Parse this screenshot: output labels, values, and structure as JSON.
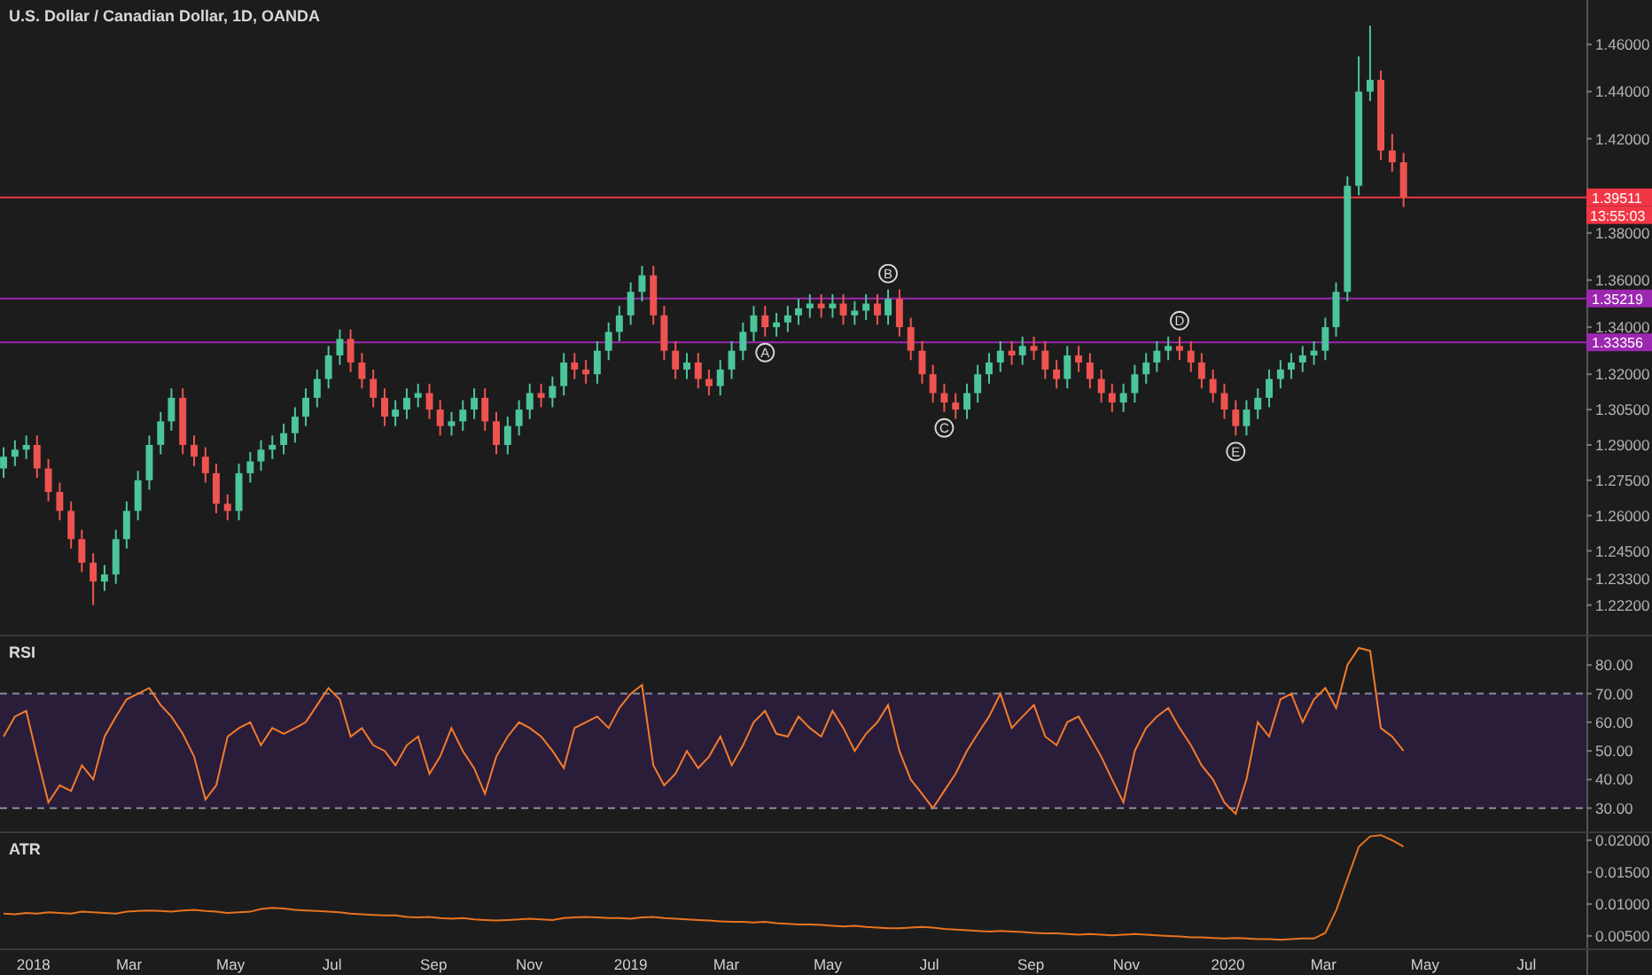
{
  "price_chart": {
    "countdown": "13:55:03",
    "chart_data": {
      "type": "candlestick",
      "x": [
        2017.95,
        2017.969,
        2017.988,
        2018.006,
        2018.025,
        2018.044,
        2018.063,
        2018.081,
        2018.1,
        2018.119,
        2018.138,
        2018.156,
        2018.175,
        2018.194,
        2018.213,
        2018.231,
        2018.25,
        2018.269,
        2018.288,
        2018.306,
        2018.325,
        2018.344,
        2018.363,
        2018.381,
        2018.4,
        2018.419,
        2018.438,
        2018.456,
        2018.475,
        2018.494,
        2018.513,
        2018.531,
        2018.55,
        2018.569,
        2018.588,
        2018.606,
        2018.625,
        2018.644,
        2018.663,
        2018.681,
        2018.7,
        2018.719,
        2018.738,
        2018.756,
        2018.775,
        2018.794,
        2018.813,
        2018.831,
        2018.85,
        2018.869,
        2018.888,
        2018.906,
        2018.925,
        2018.944,
        2018.963,
        2018.981,
        2019.0,
        2019.019,
        2019.038,
        2019.056,
        2019.075,
        2019.094,
        2019.113,
        2019.131,
        2019.15,
        2019.169,
        2019.188,
        2019.206,
        2019.225,
        2019.244,
        2019.263,
        2019.281,
        2019.3,
        2019.319,
        2019.338,
        2019.356,
        2019.375,
        2019.394,
        2019.413,
        2019.431,
        2019.45,
        2019.469,
        2019.488,
        2019.506,
        2019.525,
        2019.544,
        2019.563,
        2019.581,
        2019.6,
        2019.619,
        2019.638,
        2019.656,
        2019.675,
        2019.694,
        2019.713,
        2019.731,
        2019.75,
        2019.769,
        2019.788,
        2019.806,
        2019.825,
        2019.844,
        2019.863,
        2019.881,
        2019.9,
        2019.919,
        2019.938,
        2019.956,
        2019.975,
        2019.994,
        2020.013,
        2020.031,
        2020.05,
        2020.069,
        2020.088,
        2020.106,
        2020.125,
        2020.144,
        2020.163,
        2020.181,
        2020.2,
        2020.219,
        2020.238,
        2020.256,
        2020.275,
        2020.294
      ],
      "xlim": [
        2017.944,
        2020.71
      ],
      "ylim": [
        1.2087,
        1.4789
      ],
      "yticks": [
        {
          "value": 1.46,
          "label": "1.46000"
        },
        {
          "value": 1.44,
          "label": "1.44000"
        },
        {
          "value": 1.42,
          "label": "1.42000"
        },
        {
          "value": 1.38,
          "label": "1.38000"
        },
        {
          "value": 1.36,
          "label": "1.36000"
        },
        {
          "value": 1.34,
          "label": "1.34000"
        },
        {
          "value": 1.32,
          "label": "1.32000"
        },
        {
          "value": 1.305,
          "label": "1.30500"
        },
        {
          "value": 1.29,
          "label": "1.29000"
        },
        {
          "value": 1.275,
          "label": "1.27500"
        },
        {
          "value": 1.26,
          "label": "1.26000"
        },
        {
          "value": 1.245,
          "label": "1.24500"
        },
        {
          "value": 1.233,
          "label": "1.23300"
        },
        {
          "value": 1.222,
          "label": "1.22200"
        }
      ],
      "title": "U.S. Dollar / Canadian Dollar, 1D, OANDA",
      "series": [
        {
          "ohlc": [
            [
              1.28,
              1.289,
              1.276,
              1.285
            ],
            [
              1.285,
              1.292,
              1.281,
              1.288
            ],
            [
              1.288,
              1.294,
              1.284,
              1.29
            ],
            [
              1.29,
              1.294,
              1.276,
              1.28
            ],
            [
              1.28,
              1.284,
              1.266,
              1.27
            ],
            [
              1.27,
              1.274,
              1.258,
              1.262
            ],
            [
              1.262,
              1.266,
              1.246,
              1.25
            ],
            [
              1.25,
              1.254,
              1.236,
              1.24
            ],
            [
              1.24,
              1.244,
              1.222,
              1.232
            ],
            [
              1.232,
              1.239,
              1.228,
              1.235
            ],
            [
              1.235,
              1.254,
              1.231,
              1.25
            ],
            [
              1.25,
              1.266,
              1.246,
              1.262
            ],
            [
              1.262,
              1.279,
              1.258,
              1.275
            ],
            [
              1.275,
              1.294,
              1.271,
              1.29
            ],
            [
              1.29,
              1.304,
              1.286,
              1.3
            ],
            [
              1.3,
              1.314,
              1.296,
              1.31
            ],
            [
              1.31,
              1.314,
              1.286,
              1.29
            ],
            [
              1.29,
              1.294,
              1.281,
              1.285
            ],
            [
              1.285,
              1.289,
              1.274,
              1.278
            ],
            [
              1.278,
              1.282,
              1.261,
              1.265
            ],
            [
              1.265,
              1.269,
              1.258,
              1.262
            ],
            [
              1.262,
              1.282,
              1.258,
              1.278
            ],
            [
              1.278,
              1.287,
              1.274,
              1.283
            ],
            [
              1.283,
              1.292,
              1.279,
              1.288
            ],
            [
              1.288,
              1.294,
              1.284,
              1.29
            ],
            [
              1.29,
              1.299,
              1.286,
              1.295
            ],
            [
              1.295,
              1.306,
              1.291,
              1.302
            ],
            [
              1.302,
              1.314,
              1.298,
              1.31
            ],
            [
              1.31,
              1.322,
              1.306,
              1.318
            ],
            [
              1.318,
              1.332,
              1.314,
              1.328
            ],
            [
              1.328,
              1.339,
              1.324,
              1.335
            ],
            [
              1.335,
              1.339,
              1.321,
              1.325
            ],
            [
              1.325,
              1.329,
              1.314,
              1.318
            ],
            [
              1.318,
              1.322,
              1.306,
              1.31
            ],
            [
              1.31,
              1.314,
              1.298,
              1.302
            ],
            [
              1.302,
              1.309,
              1.298,
              1.305
            ],
            [
              1.305,
              1.314,
              1.301,
              1.31
            ],
            [
              1.31,
              1.316,
              1.306,
              1.312
            ],
            [
              1.312,
              1.316,
              1.301,
              1.305
            ],
            [
              1.305,
              1.309,
              1.294,
              1.298
            ],
            [
              1.298,
              1.304,
              1.294,
              1.3
            ],
            [
              1.3,
              1.309,
              1.296,
              1.305
            ],
            [
              1.305,
              1.314,
              1.301,
              1.31
            ],
            [
              1.31,
              1.314,
              1.296,
              1.3
            ],
            [
              1.3,
              1.304,
              1.286,
              1.29
            ],
            [
              1.29,
              1.302,
              1.286,
              1.298
            ],
            [
              1.298,
              1.309,
              1.294,
              1.305
            ],
            [
              1.305,
              1.316,
              1.301,
              1.312
            ],
            [
              1.312,
              1.316,
              1.306,
              1.31
            ],
            [
              1.31,
              1.319,
              1.306,
              1.315
            ],
            [
              1.315,
              1.329,
              1.311,
              1.325
            ],
            [
              1.325,
              1.329,
              1.318,
              1.322
            ],
            [
              1.322,
              1.326,
              1.316,
              1.32
            ],
            [
              1.32,
              1.334,
              1.316,
              1.33
            ],
            [
              1.33,
              1.342,
              1.326,
              1.338
            ],
            [
              1.338,
              1.349,
              1.334,
              1.345
            ],
            [
              1.345,
              1.359,
              1.341,
              1.355
            ],
            [
              1.355,
              1.366,
              1.351,
              1.362
            ],
            [
              1.362,
              1.366,
              1.341,
              1.345
            ],
            [
              1.345,
              1.349,
              1.326,
              1.33
            ],
            [
              1.33,
              1.334,
              1.318,
              1.322
            ],
            [
              1.322,
              1.329,
              1.318,
              1.325
            ],
            [
              1.325,
              1.329,
              1.314,
              1.318
            ],
            [
              1.318,
              1.322,
              1.311,
              1.315
            ],
            [
              1.315,
              1.326,
              1.311,
              1.322
            ],
            [
              1.322,
              1.334,
              1.318,
              1.33
            ],
            [
              1.33,
              1.342,
              1.326,
              1.338
            ],
            [
              1.338,
              1.349,
              1.334,
              1.345
            ],
            [
              1.345,
              1.349,
              1.336,
              1.34
            ],
            [
              1.34,
              1.346,
              1.336,
              1.342
            ],
            [
              1.342,
              1.349,
              1.338,
              1.345
            ],
            [
              1.345,
              1.352,
              1.341,
              1.348
            ],
            [
              1.348,
              1.354,
              1.344,
              1.35
            ],
            [
              1.35,
              1.354,
              1.344,
              1.348
            ],
            [
              1.348,
              1.354,
              1.344,
              1.35
            ],
            [
              1.35,
              1.354,
              1.341,
              1.345
            ],
            [
              1.345,
              1.351,
              1.341,
              1.347
            ],
            [
              1.347,
              1.354,
              1.343,
              1.35
            ],
            [
              1.35,
              1.354,
              1.341,
              1.345
            ],
            [
              1.345,
              1.356,
              1.341,
              1.352
            ],
            [
              1.352,
              1.356,
              1.336,
              1.34
            ],
            [
              1.34,
              1.344,
              1.326,
              1.33
            ],
            [
              1.33,
              1.334,
              1.316,
              1.32
            ],
            [
              1.32,
              1.324,
              1.308,
              1.312
            ],
            [
              1.312,
              1.316,
              1.304,
              1.308
            ],
            [
              1.308,
              1.312,
              1.301,
              1.305
            ],
            [
              1.305,
              1.316,
              1.301,
              1.312
            ],
            [
              1.312,
              1.324,
              1.308,
              1.32
            ],
            [
              1.32,
              1.329,
              1.316,
              1.325
            ],
            [
              1.325,
              1.334,
              1.321,
              1.33
            ],
            [
              1.33,
              1.334,
              1.324,
              1.328
            ],
            [
              1.328,
              1.336,
              1.324,
              1.332
            ],
            [
              1.332,
              1.336,
              1.326,
              1.33
            ],
            [
              1.33,
              1.334,
              1.318,
              1.322
            ],
            [
              1.322,
              1.326,
              1.314,
              1.318
            ],
            [
              1.318,
              1.332,
              1.314,
              1.328
            ],
            [
              1.328,
              1.332,
              1.321,
              1.325
            ],
            [
              1.325,
              1.329,
              1.314,
              1.318
            ],
            [
              1.318,
              1.322,
              1.308,
              1.312
            ],
            [
              1.312,
              1.316,
              1.304,
              1.308
            ],
            [
              1.308,
              1.316,
              1.304,
              1.312
            ],
            [
              1.312,
              1.324,
              1.308,
              1.32
            ],
            [
              1.32,
              1.329,
              1.316,
              1.325
            ],
            [
              1.325,
              1.334,
              1.321,
              1.33
            ],
            [
              1.33,
              1.336,
              1.326,
              1.332
            ],
            [
              1.332,
              1.336,
              1.326,
              1.33
            ],
            [
              1.33,
              1.334,
              1.321,
              1.325
            ],
            [
              1.325,
              1.329,
              1.314,
              1.318
            ],
            [
              1.318,
              1.322,
              1.308,
              1.312
            ],
            [
              1.312,
              1.316,
              1.301,
              1.305
            ],
            [
              1.305,
              1.309,
              1.294,
              1.298
            ],
            [
              1.298,
              1.309,
              1.294,
              1.305
            ],
            [
              1.305,
              1.314,
              1.301,
              1.31
            ],
            [
              1.31,
              1.322,
              1.306,
              1.318
            ],
            [
              1.318,
              1.326,
              1.314,
              1.322
            ],
            [
              1.322,
              1.329,
              1.318,
              1.325
            ],
            [
              1.325,
              1.332,
              1.321,
              1.328
            ],
            [
              1.328,
              1.334,
              1.324,
              1.33
            ],
            [
              1.33,
              1.344,
              1.326,
              1.34
            ],
            [
              1.34,
              1.359,
              1.336,
              1.355
            ],
            [
              1.355,
              1.404,
              1.351,
              1.4
            ],
            [
              1.4,
              1.455,
              1.396,
              1.44
            ],
            [
              1.44,
              1.468,
              1.436,
              1.445
            ],
            [
              1.445,
              1.449,
              1.411,
              1.415
            ],
            [
              1.415,
              1.422,
              1.406,
              1.41
            ],
            [
              1.41,
              1.414,
              1.391,
              1.395
            ]
          ]
        }
      ],
      "ref_lines": [
        {
          "axis": "y",
          "value": 1.39511,
          "label": "1.39511",
          "color": "#f23645"
        },
        {
          "axis": "y",
          "value": 1.35219,
          "label": "1.35219",
          "color": "#9c27b0"
        },
        {
          "axis": "y",
          "value": 1.33356,
          "label": "1.33356",
          "color": "#9c27b0"
        }
      ],
      "annotations": [
        {
          "text": "A",
          "x": 2019.225,
          "y": 1.336
        },
        {
          "text": "B",
          "x": 2019.431,
          "y": 1.356
        },
        {
          "text": "C",
          "x": 2019.525,
          "y": 1.304
        },
        {
          "text": "D",
          "x": 2019.919,
          "y": 1.336
        },
        {
          "text": "E",
          "x": 2020.013,
          "y": 1.294
        }
      ]
    }
  },
  "rsi_pane": {
    "chart_data": {
      "type": "line",
      "x": [
        2017.95,
        2017.969,
        2017.988,
        2018.006,
        2018.025,
        2018.044,
        2018.063,
        2018.081,
        2018.1,
        2018.119,
        2018.138,
        2018.156,
        2018.175,
        2018.194,
        2018.213,
        2018.231,
        2018.25,
        2018.269,
        2018.288,
        2018.306,
        2018.325,
        2018.344,
        2018.363,
        2018.381,
        2018.4,
        2018.419,
        2018.438,
        2018.456,
        2018.475,
        2018.494,
        2018.513,
        2018.531,
        2018.55,
        2018.569,
        2018.588,
        2018.606,
        2018.625,
        2018.644,
        2018.663,
        2018.681,
        2018.7,
        2018.719,
        2018.738,
        2018.756,
        2018.775,
        2018.794,
        2018.813,
        2018.831,
        2018.85,
        2018.869,
        2018.888,
        2018.906,
        2018.925,
        2018.944,
        2018.963,
        2018.981,
        2019.0,
        2019.019,
        2019.038,
        2019.056,
        2019.075,
        2019.094,
        2019.113,
        2019.131,
        2019.15,
        2019.169,
        2019.188,
        2019.206,
        2019.225,
        2019.244,
        2019.263,
        2019.281,
        2019.3,
        2019.319,
        2019.338,
        2019.356,
        2019.375,
        2019.394,
        2019.413,
        2019.431,
        2019.45,
        2019.469,
        2019.488,
        2019.506,
        2019.525,
        2019.544,
        2019.563,
        2019.581,
        2019.6,
        2019.619,
        2019.638,
        2019.656,
        2019.675,
        2019.694,
        2019.713,
        2019.731,
        2019.75,
        2019.769,
        2019.788,
        2019.806,
        2019.825,
        2019.844,
        2019.863,
        2019.881,
        2019.9,
        2019.919,
        2019.938,
        2019.956,
        2019.975,
        2019.994,
        2020.013,
        2020.031,
        2020.05,
        2020.069,
        2020.088,
        2020.106,
        2020.125,
        2020.144,
        2020.163,
        2020.181,
        2020.2,
        2020.219,
        2020.238,
        2020.256,
        2020.275,
        2020.294
      ],
      "xlim": [
        2017.944,
        2020.71
      ],
      "ylim": [
        21.25,
        90
      ],
      "yticks": [
        {
          "value": 80,
          "label": "80.00"
        },
        {
          "value": 70,
          "label": "70.00"
        },
        {
          "value": 60,
          "label": "60.00"
        },
        {
          "value": 50,
          "label": "50.00"
        },
        {
          "value": 40,
          "label": "40.00"
        },
        {
          "value": 30,
          "label": "30.00"
        }
      ],
      "series": [
        {
          "name": "RSI",
          "color": "#f57c2a",
          "values": [
            55,
            62,
            64,
            48,
            32,
            38,
            36,
            45,
            40,
            55,
            62,
            68,
            70,
            72,
            66,
            62,
            56,
            48,
            33,
            38,
            55,
            58,
            60,
            52,
            58,
            56,
            58,
            60,
            66,
            72,
            68,
            55,
            58,
            52,
            50,
            45,
            52,
            55,
            42,
            48,
            58,
            50,
            44,
            35,
            48,
            55,
            60,
            58,
            55,
            50,
            44,
            58,
            60,
            62,
            58,
            65,
            70,
            73,
            45,
            38,
            42,
            50,
            44,
            48,
            55,
            45,
            52,
            60,
            64,
            56,
            55,
            62,
            58,
            55,
            64,
            58,
            50,
            56,
            60,
            66,
            50,
            40,
            35,
            30,
            36,
            42,
            50,
            56,
            62,
            70,
            58,
            62,
            66,
            55,
            52,
            60,
            62,
            55,
            48,
            40,
            32,
            50,
            58,
            62,
            65,
            58,
            52,
            45,
            40,
            32,
            28,
            40,
            60,
            55,
            68,
            70,
            60,
            68,
            72,
            65,
            80,
            86,
            85,
            58,
            55,
            50
          ]
        }
      ],
      "ref_lines": [
        {
          "axis": "y",
          "value": 70
        },
        {
          "axis": "y",
          "value": 30
        }
      ],
      "bands": [
        {
          "axis": "y",
          "from": 30,
          "to": 70
        }
      ]
    }
  },
  "atr_pane": {
    "chart_data": {
      "type": "line",
      "x": [
        2017.95,
        2017.969,
        2017.988,
        2018.006,
        2018.025,
        2018.044,
        2018.063,
        2018.081,
        2018.1,
        2018.119,
        2018.138,
        2018.156,
        2018.175,
        2018.194,
        2018.213,
        2018.231,
        2018.25,
        2018.269,
        2018.288,
        2018.306,
        2018.325,
        2018.344,
        2018.363,
        2018.381,
        2018.4,
        2018.419,
        2018.438,
        2018.456,
        2018.475,
        2018.494,
        2018.513,
        2018.531,
        2018.55,
        2018.569,
        2018.588,
        2018.606,
        2018.625,
        2018.644,
        2018.663,
        2018.681,
        2018.7,
        2018.719,
        2018.738,
        2018.756,
        2018.775,
        2018.794,
        2018.813,
        2018.831,
        2018.85,
        2018.869,
        2018.888,
        2018.906,
        2018.925,
        2018.944,
        2018.963,
        2018.981,
        2019.0,
        2019.019,
        2019.038,
        2019.056,
        2019.075,
        2019.094,
        2019.113,
        2019.131,
        2019.15,
        2019.169,
        2019.188,
        2019.206,
        2019.225,
        2019.244,
        2019.263,
        2019.281,
        2019.3,
        2019.319,
        2019.338,
        2019.356,
        2019.375,
        2019.394,
        2019.413,
        2019.431,
        2019.45,
        2019.469,
        2019.488,
        2019.506,
        2019.525,
        2019.544,
        2019.563,
        2019.581,
        2019.6,
        2019.619,
        2019.638,
        2019.656,
        2019.675,
        2019.694,
        2019.713,
        2019.731,
        2019.75,
        2019.769,
        2019.788,
        2019.806,
        2019.825,
        2019.844,
        2019.863,
        2019.881,
        2019.9,
        2019.919,
        2019.938,
        2019.956,
        2019.975,
        2019.994,
        2020.013,
        2020.031,
        2020.05,
        2020.069,
        2020.088,
        2020.106,
        2020.125,
        2020.144,
        2020.163,
        2020.181,
        2020.2,
        2020.219,
        2020.238,
        2020.256,
        2020.275,
        2020.294
      ],
      "xlim": [
        2017.944,
        2020.71
      ],
      "ylim": [
        0.00277,
        0.0211
      ],
      "yticks": [
        {
          "value": 0.02,
          "label": "0.02000"
        },
        {
          "value": 0.015,
          "label": "0.01500"
        },
        {
          "value": 0.01,
          "label": "0.01000"
        },
        {
          "value": 0.005,
          "label": "0.00500"
        }
      ],
      "xticks": [
        {
          "value": 2018,
          "label": "2018"
        },
        {
          "value": 2018.16,
          "label": "Mar"
        },
        {
          "value": 2018.33,
          "label": "May"
        },
        {
          "value": 2018.5,
          "label": "Jul"
        },
        {
          "value": 2018.67,
          "label": "Sep"
        },
        {
          "value": 2018.83,
          "label": "Nov"
        },
        {
          "value": 2019,
          "label": "2019"
        },
        {
          "value": 2019.16,
          "label": "Mar"
        },
        {
          "value": 2019.33,
          "label": "May"
        },
        {
          "value": 2019.5,
          "label": "Jul"
        },
        {
          "value": 2019.67,
          "label": "Sep"
        },
        {
          "value": 2019.83,
          "label": "Nov"
        },
        {
          "value": 2020,
          "label": "2020"
        },
        {
          "value": 2020.16,
          "label": "Mar"
        },
        {
          "value": 2020.33,
          "label": "May"
        },
        {
          "value": 2020.5,
          "label": "Jul"
        }
      ],
      "series": [
        {
          "name": "ATR",
          "color": "#e8731f",
          "values": [
            0.0085,
            0.0084,
            0.0086,
            0.0085,
            0.0087,
            0.0086,
            0.0085,
            0.0088,
            0.0087,
            0.0086,
            0.0085,
            0.0088,
            0.0089,
            0.009,
            0.0089,
            0.0088,
            0.009,
            0.0091,
            0.0089,
            0.0088,
            0.0086,
            0.0087,
            0.0088,
            0.0092,
            0.0094,
            0.0093,
            0.0091,
            0.009,
            0.0089,
            0.0088,
            0.0087,
            0.0085,
            0.0084,
            0.0083,
            0.0082,
            0.0082,
            0.008,
            0.0079,
            0.008,
            0.0078,
            0.0077,
            0.0078,
            0.0076,
            0.0075,
            0.0074,
            0.0075,
            0.0076,
            0.0077,
            0.0076,
            0.0075,
            0.0078,
            0.0079,
            0.008,
            0.0079,
            0.0078,
            0.0078,
            0.0077,
            0.0079,
            0.008,
            0.0078,
            0.0077,
            0.0076,
            0.0075,
            0.0074,
            0.0073,
            0.0072,
            0.0072,
            0.0071,
            0.0072,
            0.007,
            0.0069,
            0.0068,
            0.0068,
            0.0067,
            0.0066,
            0.0065,
            0.0066,
            0.0064,
            0.0063,
            0.0062,
            0.0062,
            0.0063,
            0.0064,
            0.0063,
            0.0061,
            0.006,
            0.0059,
            0.0058,
            0.0057,
            0.0058,
            0.0057,
            0.0056,
            0.0055,
            0.0054,
            0.0054,
            0.0053,
            0.0052,
            0.0053,
            0.0052,
            0.0051,
            0.0052,
            0.0053,
            0.0052,
            0.0051,
            0.005,
            0.0049,
            0.0048,
            0.0048,
            0.0047,
            0.0046,
            0.0047,
            0.0046,
            0.0045,
            0.0045,
            0.0044,
            0.0045,
            0.0046,
            0.0046,
            0.0055,
            0.009,
            0.014,
            0.019,
            0.0206,
            0.0208,
            0.02,
            0.019
          ]
        }
      ]
    }
  }
}
